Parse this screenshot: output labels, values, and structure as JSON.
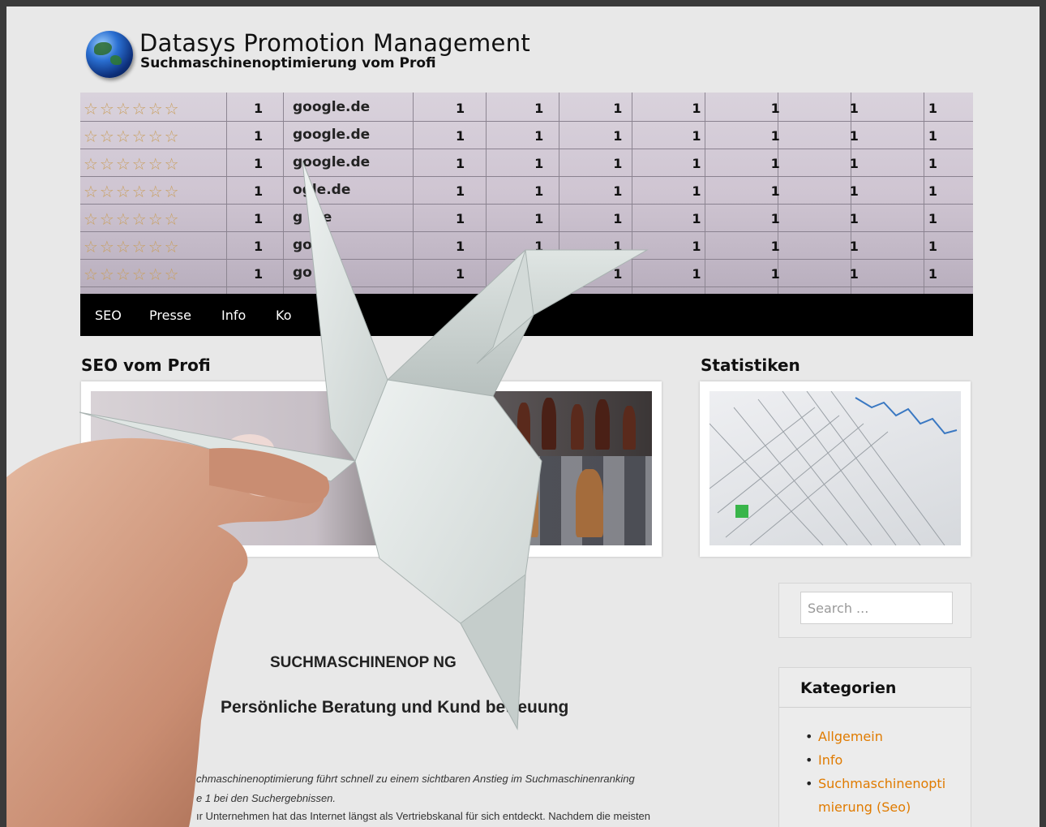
{
  "site": {
    "title": "Datasys Promotion Management",
    "description": "Suchmaschinenoptimierung vom Profi"
  },
  "banner": {
    "rows": [
      {
        "rank": "1",
        "engine": "google.de"
      },
      {
        "rank": "1",
        "engine": "google.de"
      },
      {
        "rank": "1",
        "engine": "google.de"
      },
      {
        "rank": "1",
        "engine": "ogle.de"
      },
      {
        "rank": "1",
        "engine": "g     .de"
      },
      {
        "rank": "1",
        "engine": "go"
      },
      {
        "rank": "1",
        "engine": "go"
      }
    ],
    "cell_value": "1"
  },
  "nav": {
    "items": [
      "SEO",
      "Presse",
      "Info",
      "Ko"
    ]
  },
  "widgets": {
    "left_heading": "SEO vom Profi",
    "right_heading": "Statistiken"
  },
  "search": {
    "placeholder": "Search ..."
  },
  "categories": {
    "title": "Kategorien",
    "items": [
      "Allgemein",
      "Info",
      "Suchmaschinenopti mierung (Seo)"
    ]
  },
  "content": {
    "title": "SUCHMASCHINENOP        NG",
    "subtitle": "Persönliche Beratung und Kund    betreuung",
    "p1": "chmaschinenoptimierung führt schnell zu einem sichtbaren Anstieg im Suchmaschinenranking",
    "p2": "e 1 bei den Suchergebnissen.",
    "p3": "ır Unternehmen hat das Internet längst als Vertriebskanal für sich entdeckt. Nachdem die meisten"
  },
  "colors": {
    "accent": "#e07b00",
    "nav_bg": "#000000",
    "page_bg": "#e8e8e8"
  }
}
